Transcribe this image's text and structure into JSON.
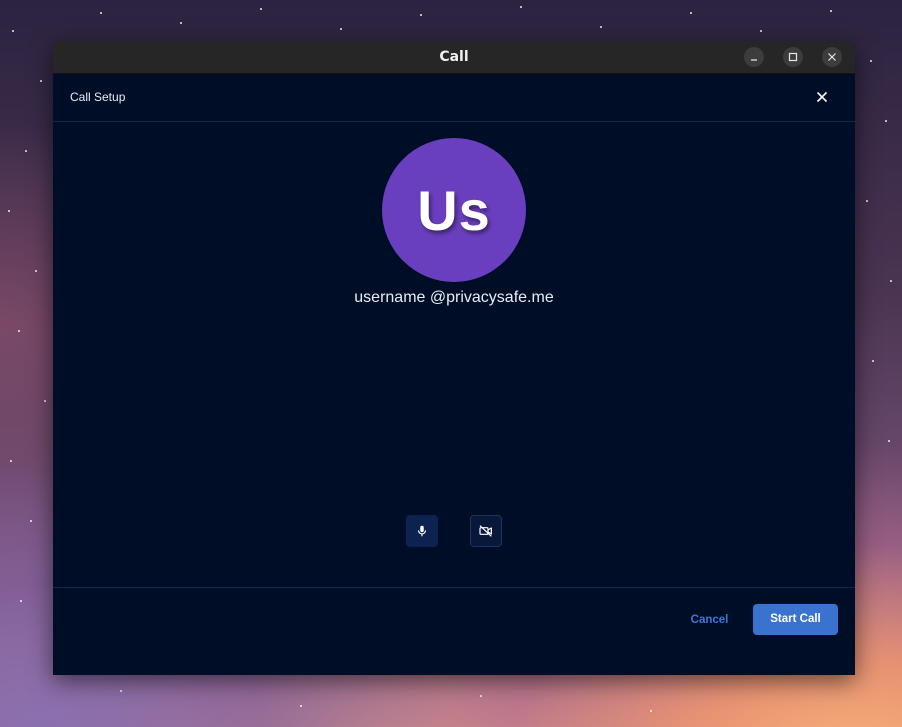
{
  "window": {
    "title": "Call"
  },
  "dialog": {
    "title": "Call Setup"
  },
  "contact": {
    "initials": "Us",
    "name": "username @privacysafe.me",
    "avatar_color": "#6a3fbf"
  },
  "controls": {
    "microphone_icon": "microphone-icon",
    "camera_icon": "camera-off-icon"
  },
  "actions": {
    "cancel_label": "Cancel",
    "start_label": "Start Call"
  },
  "colors": {
    "background": "#000d26",
    "accent": "#3a73cf",
    "link": "#3d78d8"
  }
}
